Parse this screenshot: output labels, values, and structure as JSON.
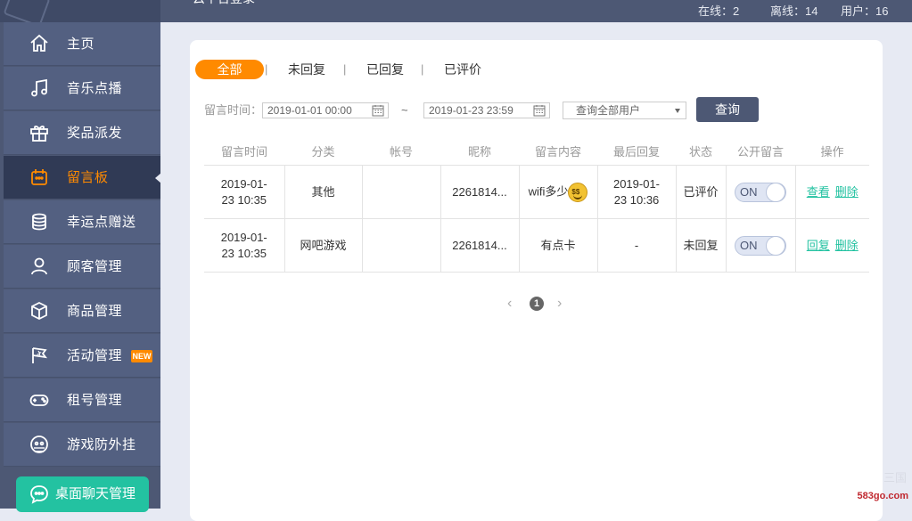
{
  "sidebar": {
    "items": [
      {
        "label": "主页",
        "icon": "home-icon"
      },
      {
        "label": "音乐点播",
        "icon": "music-icon"
      },
      {
        "label": "奖品派发",
        "icon": "gift-icon"
      },
      {
        "label": "留言板",
        "icon": "message-board-icon",
        "active": true
      },
      {
        "label": "幸运点赠送",
        "icon": "coins-icon"
      },
      {
        "label": "顾客管理",
        "icon": "user-icon"
      },
      {
        "label": "商品管理",
        "icon": "box-icon"
      },
      {
        "label": "活动管理",
        "icon": "flag-icon",
        "badge": "NEW"
      },
      {
        "label": "租号管理",
        "icon": "gamepad-icon"
      },
      {
        "label": "游戏防外挂",
        "icon": "shield-icon"
      }
    ],
    "chat_button": "桌面聊天管理"
  },
  "topbar": {
    "title_fragment": "云平台登录",
    "online": "在线：2",
    "offline": "离线：14",
    "users": "用户：16"
  },
  "tabs": {
    "all": "全部",
    "unreplied": "未回复",
    "replied": "已回复",
    "rated": "已评价",
    "sep": "|"
  },
  "filter": {
    "label": "留言时间：",
    "start": "2019-01-01 00:00",
    "tilde": "~",
    "end": "2019-01-23 23:59",
    "user_select": "查询全部用户",
    "query_button": "查询"
  },
  "table": {
    "headers": [
      "留言时间",
      "分类",
      "帐号",
      "昵称",
      "留言内容",
      "最后回复",
      "状态",
      "公开留言",
      "操作"
    ],
    "rows": [
      {
        "time_line1": "2019-01-",
        "time_line2": "23 10:35",
        "category": "其他",
        "account": "",
        "nickname": "2261814...",
        "content": "wifi多少",
        "emoji": "money-face-emoji",
        "last_reply_line1": "2019-01-",
        "last_reply_line2": "23 10:36",
        "status": "已评价",
        "toggle": "ON",
        "action1": "查看",
        "action2": "删除"
      },
      {
        "time_line1": "2019-01-",
        "time_line2": "23 10:35",
        "category": "网吧游戏",
        "account": "",
        "nickname": "2261814...",
        "content": "有点卡",
        "last_reply": "-",
        "status": "未回复",
        "toggle": "ON",
        "action1": "回复",
        "action2": "删除"
      }
    ]
  },
  "pager": {
    "prev": "‹",
    "current": "1",
    "next": "›"
  },
  "watermark": {
    "text": "583go.com",
    "text2": "三国"
  },
  "colors": {
    "accent": "#ff8a00",
    "sidebar": "#4d5874",
    "link": "#23c2a1"
  }
}
